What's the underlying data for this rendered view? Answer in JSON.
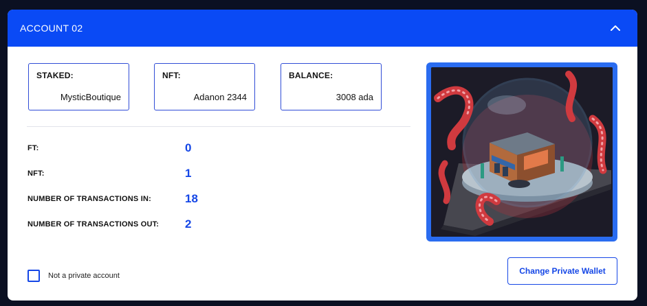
{
  "account": {
    "title": "ACCOUNT 02"
  },
  "summary": [
    {
      "label": "STAKED:",
      "value": "MysticBoutique"
    },
    {
      "label": "NFT:",
      "value": "Adanon 2344"
    },
    {
      "label": "BALANCE:",
      "value": "3008 ada"
    }
  ],
  "stats": [
    {
      "label": "FT:",
      "value": "0"
    },
    {
      "label": "NFT:",
      "value": "1"
    },
    {
      "label": "NUMBER OF TRANSACTIONS IN:",
      "value": "18"
    },
    {
      "label": "NUMBER OF TRANSACTIONS OUT:",
      "value": "2"
    }
  ],
  "private_account": {
    "label": "Not a private account",
    "checked": false
  },
  "actions": {
    "change_wallet_label": "Change Private Wallet"
  },
  "icons": {
    "collapse": "chevron-up-icon",
    "nft_image": "nft-image"
  },
  "colors": {
    "accent": "#0a4af5",
    "value_blue": "#1446e6",
    "nft_frame": "#2a6cf0",
    "background": "#0b1022"
  }
}
